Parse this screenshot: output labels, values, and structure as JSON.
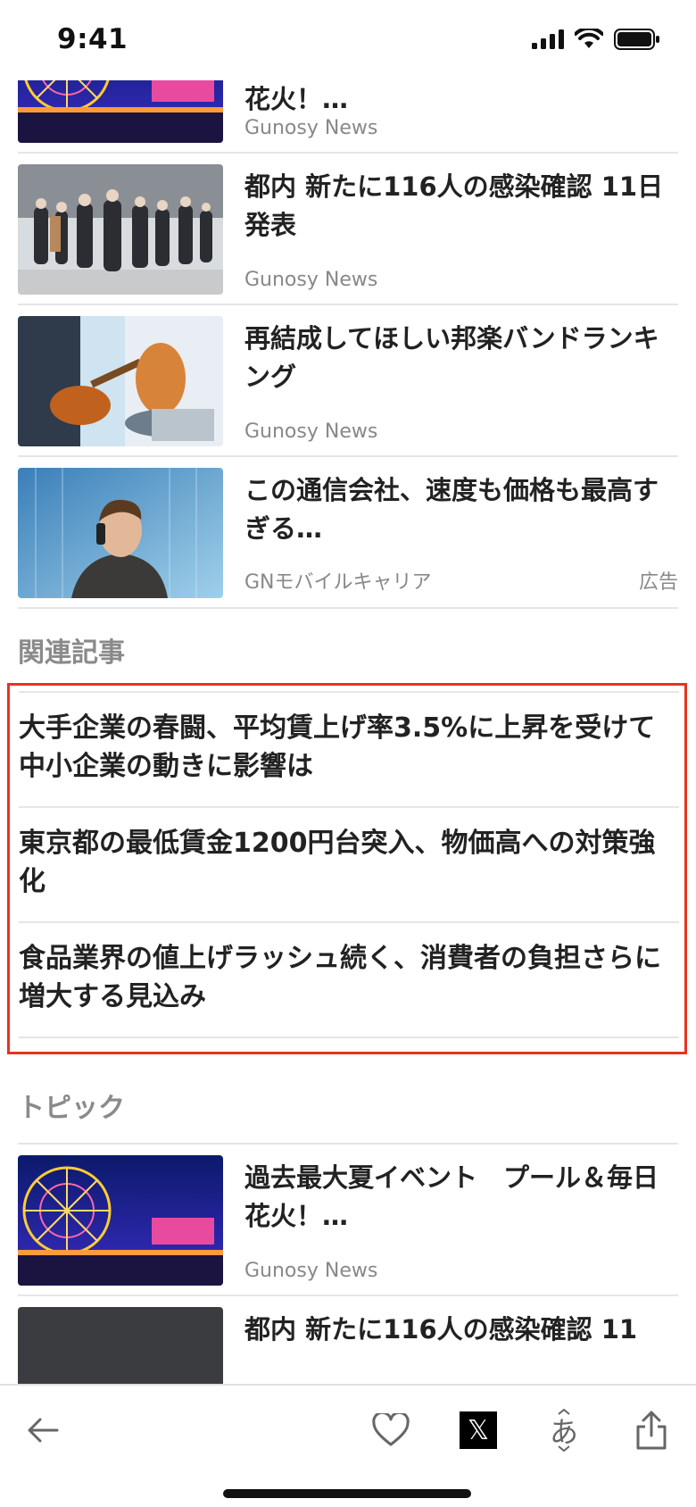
{
  "status_bar": {
    "time": "9:41"
  },
  "articles_top": [
    {
      "title": "花火！…",
      "source": "Gunosy News",
      "ad": ""
    },
    {
      "title": "都内 新たに116人の感染確認 11日発表",
      "source": "Gunosy News",
      "ad": ""
    },
    {
      "title": "再結成してほしい邦楽バンドランキング",
      "source": "Gunosy News",
      "ad": ""
    },
    {
      "title": "この通信会社、速度も価格も最高すぎる…",
      "source": "GNモバイルキャリア",
      "ad": "広告"
    }
  ],
  "related": {
    "heading": "関連記事",
    "items": [
      "大手企業の春闘、平均賃上げ率3.5%に上昇を受けて中小企業の動きに影響は",
      "東京都の最低賃金1200円台突入、物価高への対策強化",
      "食品業界の値上げラッシュ続く、消費者の負担さらに増大する見込み"
    ]
  },
  "topic": {
    "heading": "トピック",
    "articles": [
      {
        "title": "過去最大夏イベント　プール＆毎日花火！…",
        "source": "Gunosy News"
      },
      {
        "title": "都内 新たに116人の感染確認 11",
        "source": ""
      }
    ]
  },
  "toolbar": {
    "icons": [
      "back-arrow-icon",
      "heart-icon",
      "x-logo-icon",
      "font-size-icon",
      "share-icon"
    ],
    "x_logo_text": "𝕏",
    "font_glyph": "あ"
  },
  "colors": {
    "highlight_border": "#e8331f",
    "divider": "#e5e5e5",
    "muted_text": "#888888"
  }
}
